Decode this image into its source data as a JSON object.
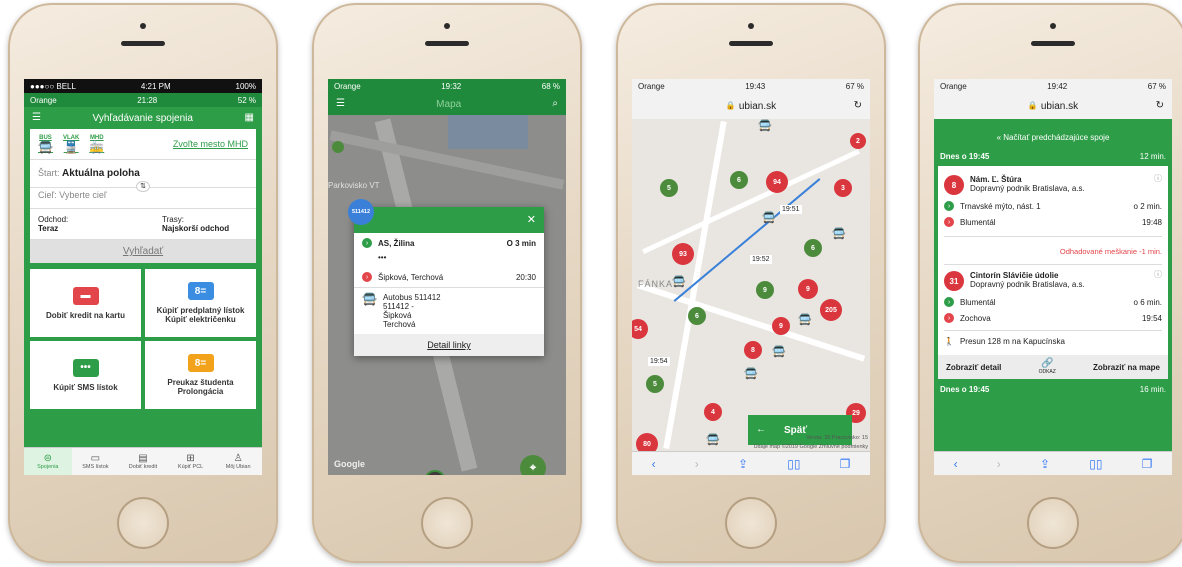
{
  "phone1": {
    "status_outer": {
      "carrier": "●●●○○ BELL",
      "time": "4:21 PM",
      "battery": "100%"
    },
    "status_inner": {
      "carrier": "Orange",
      "time": "21:28",
      "battery": "52 %"
    },
    "title": "Vyhľadávanie spojenia",
    "modes": [
      {
        "label": "BUS"
      },
      {
        "label": "VLAK"
      },
      {
        "label": "MHD"
      }
    ],
    "choose_city": "Zvoľte mesto MHD",
    "start_label": "Štart:",
    "start_value": "Aktuálna poloha",
    "target_label": "Cieľ:",
    "target_placeholder": "Vyberte cieľ",
    "departure_label": "Odchod:",
    "departure_value": "Teraz",
    "routes_label": "Trasy:",
    "routes_value": "Najskorší odchod",
    "search_button": "Vyhľadať",
    "tiles": [
      {
        "label": "Dobiť kredit na kartu",
        "color": "#e2454a"
      },
      {
        "label": "Kúpiť predplatný lístok Kúpiť električenku",
        "color": "#3a8de0"
      },
      {
        "label": "Kúpiť SMS lístok",
        "color": "#2e9d48"
      },
      {
        "label": "Preukaz študenta Prolongácia",
        "color": "#f2a31b"
      }
    ],
    "tabs": [
      {
        "label": "Spojenia"
      },
      {
        "label": "SMS lístok"
      },
      {
        "label": "Dobiť kredit"
      },
      {
        "label": "Kúpiť PCL"
      },
      {
        "label": "Môj Ubian"
      }
    ]
  },
  "phone2": {
    "status": {
      "carrier": "Orange",
      "time": "19:32",
      "battery": "68 %"
    },
    "title": "Mapa",
    "map_labels": {
      "parking": "Parkovisko VT",
      "google": "Google"
    },
    "popup": {
      "badge": "511412",
      "from": "AS, Žilina",
      "from_time": "O 3 min",
      "dots": "•••",
      "to": "Šipková, Terchová",
      "to_time": "20:30",
      "vehicle": "Autobus 511412",
      "route": "511412 - Šipková Terchová",
      "detail_link": "Detail linky"
    },
    "cluster": "26"
  },
  "phone3": {
    "status": {
      "carrier": "Orange",
      "time": "19:43",
      "battery": "67 %"
    },
    "url": "ubian.sk",
    "map_labels": {
      "fanka": "FÁNKA"
    },
    "time_tags": [
      "19:51",
      "19:52",
      "19:54"
    ],
    "pins_red": [
      "2",
      "94",
      "3",
      "93",
      "9",
      "205",
      "9",
      "8",
      "4",
      "29",
      "80",
      "54"
    ],
    "pins_green": [
      "5",
      "6",
      "6",
      "9",
      "6",
      "5"
    ],
    "back_button": "Späť",
    "attribution": "Údaje máp ©2019 Google    Zmluvné podmienky",
    "version": "Verzia: 35 Pracovisko: 15"
  },
  "phone4": {
    "status": {
      "carrier": "Orange",
      "time": "19:42",
      "battery": "67 %"
    },
    "url": "ubian.sk",
    "load_previous": "« Načítať predchádzajúce spoje",
    "today1": "Dnes o 19:45",
    "today1_min": "12 min.",
    "conn1": {
      "line": "8",
      "stop": "Nám. Ľ. Štúra",
      "operator": "Dopravný podnik Bratislava, a.s.",
      "from": "Trnavské mýto, nást. 1",
      "from_time": "o 2 min.",
      "to": "Blumentál",
      "to_time": "19:48"
    },
    "delay": "Odhadované meškanie -1 min.",
    "conn2": {
      "line": "31",
      "stop": "Cintorín Slávičie údolie",
      "operator": "Dopravný podnik Bratislava, a.s.",
      "from": "Blumentál",
      "from_time": "o 6 min.",
      "to": "Zochova",
      "to_time": "19:54"
    },
    "walk": "Presun 128 m na Kapucínska",
    "detail_btn": "Zobraziť detail",
    "link_label": "ODKAZ",
    "map_btn": "Zobraziť na mape",
    "today2": "Dnes o 19:45",
    "today2_min": "16 min."
  }
}
